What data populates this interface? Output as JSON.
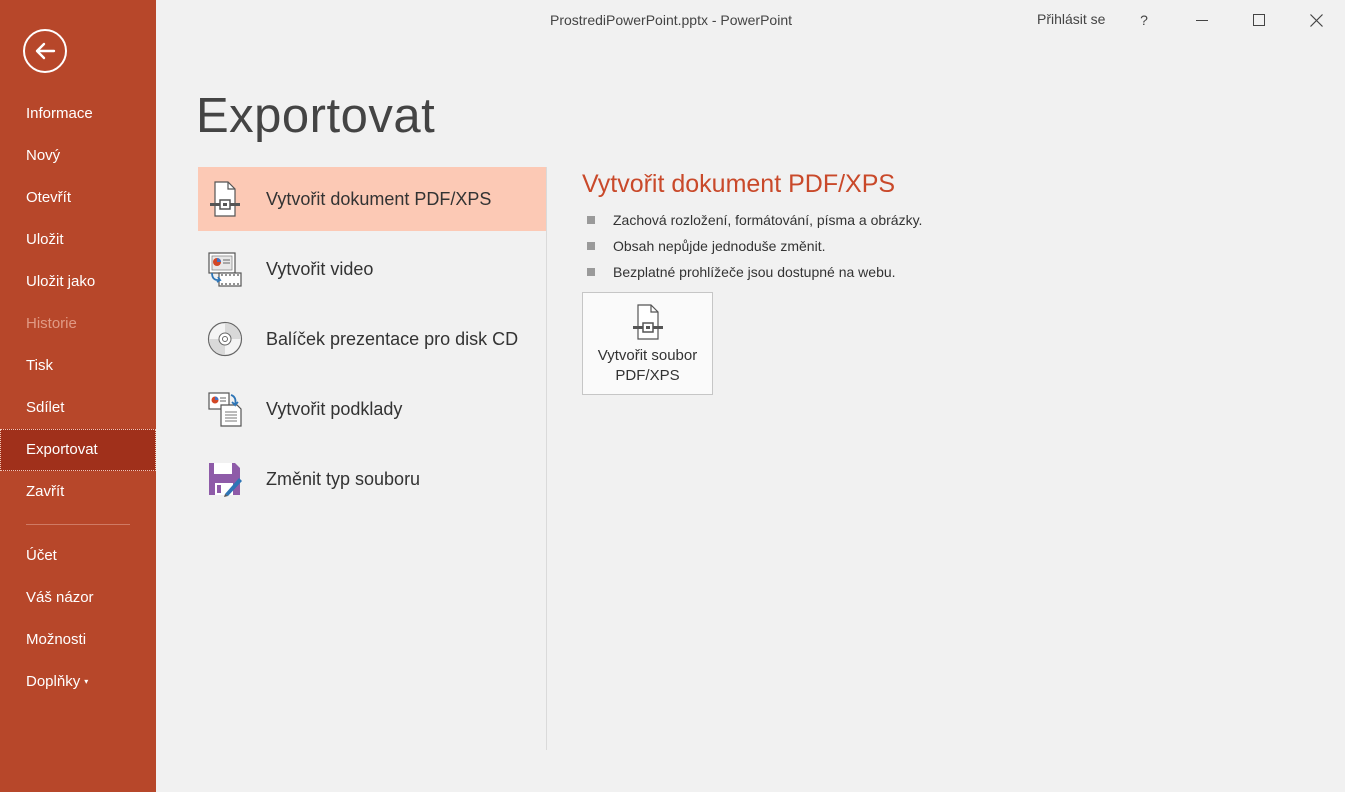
{
  "window": {
    "title": "ProstrediPowerPoint.pptx  -  PowerPoint",
    "sign_in": "Přihlásit se",
    "help": "?"
  },
  "sidebar": {
    "items": [
      {
        "label": "Informace"
      },
      {
        "label": "Nový"
      },
      {
        "label": "Otevřít"
      },
      {
        "label": "Uložit"
      },
      {
        "label": "Uložit jako"
      },
      {
        "label": "Historie",
        "state": "disabled"
      },
      {
        "label": "Tisk"
      },
      {
        "label": "Sdílet"
      },
      {
        "label": "Exportovat",
        "state": "selected"
      },
      {
        "label": "Zavřít"
      }
    ],
    "bottom_items": [
      {
        "label": "Účet"
      },
      {
        "label": "Váš názor"
      },
      {
        "label": "Možnosti"
      },
      {
        "label": "Doplňky"
      }
    ]
  },
  "main": {
    "heading": "Exportovat",
    "options": [
      {
        "label": "Vytvořit dokument PDF/XPS",
        "icon": "pdf-document-icon",
        "selected": true
      },
      {
        "label": "Vytvořit video",
        "icon": "video-icon"
      },
      {
        "label": "Balíček prezentace pro disk CD",
        "icon": "cd-icon"
      },
      {
        "label": "Vytvořit podklady",
        "icon": "handouts-icon"
      },
      {
        "label": "Změnit typ souboru",
        "icon": "change-file-type-icon"
      }
    ],
    "detail": {
      "title": "Vytvořit dokument PDF/XPS",
      "bullets": [
        "Zachová rozložení, formátování, písma a obrázky.",
        "Obsah nepůjde jednoduše změnit.",
        "Bezplatné prohlížeče jsou dostupné na webu."
      ],
      "button_line1": "Vytvořit soubor",
      "button_line2": "PDF/XPS"
    }
  },
  "colors": {
    "sidebar": "#b7472a",
    "sidebar_active": "#a0301b",
    "selected_option": "#fcc9b5",
    "accent_title": "#c9492a"
  }
}
